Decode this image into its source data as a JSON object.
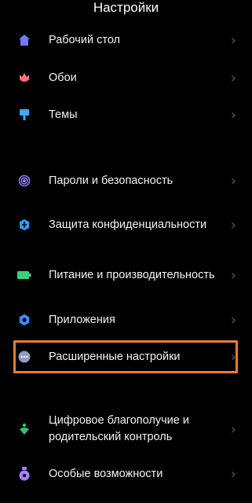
{
  "header": {
    "title": "Настройки"
  },
  "items": [
    {
      "label": "Рабочий стол",
      "icon": "home-icon",
      "color": "#6e7cff"
    },
    {
      "label": "Обои",
      "icon": "tulip-icon",
      "color": "#ff6f7c"
    },
    {
      "label": "Темы",
      "icon": "brush-icon",
      "color": "#3da9f5"
    },
    {
      "label": "Пароли и безопасность",
      "icon": "fingerprint-icon",
      "color": "#8a7cff"
    },
    {
      "label": "Защита конфиденциальности",
      "icon": "privacy-shield-icon",
      "color": "#2f9bff"
    },
    {
      "label": "Питание и производительность",
      "icon": "battery-icon",
      "color": "#34d27a"
    },
    {
      "label": "Приложения",
      "icon": "gear-icon",
      "color": "#3d8cff"
    },
    {
      "label": "Расширенные настройки",
      "icon": "more-dots-icon",
      "color": "#8c9cc4",
      "highlighted": true
    },
    {
      "label": "Цифровое благополучие и родительский контроль",
      "icon": "wellbeing-icon",
      "color": "#38c172"
    },
    {
      "label": "Особые возможности",
      "icon": "accessibility-icon",
      "color": "#a77dff"
    }
  ],
  "colors": {
    "background": "#000000",
    "highlight_border": "#f17a2c",
    "chevron": "#5a5a5a"
  },
  "chevron_glyph": "›"
}
